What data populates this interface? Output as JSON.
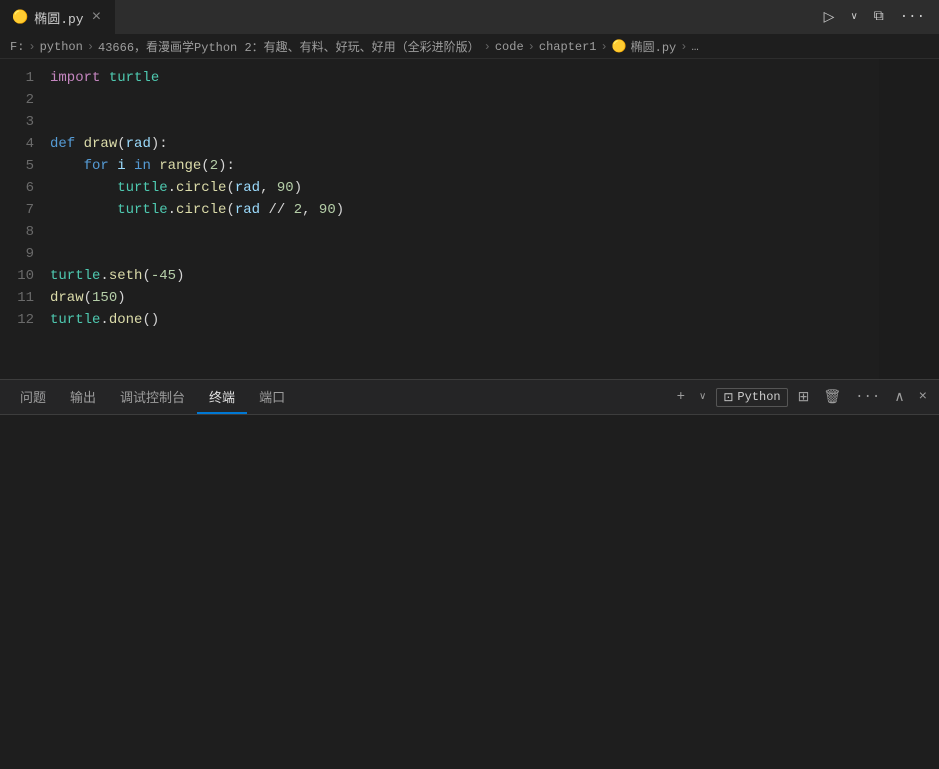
{
  "tab": {
    "icon": "🟡",
    "filename": "椭圆.py",
    "close_label": "×"
  },
  "tab_actions": {
    "run": "▷",
    "run_dropdown": "∨",
    "split": "⧉",
    "more": "···"
  },
  "breadcrumb": {
    "items": [
      "F:",
      "python",
      "43666，看漫画学Python 2：有趣、有料、好玩、好用（全彩进阶版）",
      "code",
      "chapter1",
      "椭圆.py",
      "…"
    ]
  },
  "code": {
    "lines": [
      {
        "num": "1",
        "tokens": [
          {
            "t": "kw2",
            "v": "import"
          },
          {
            "t": "plain",
            "v": " "
          },
          {
            "t": "mod",
            "v": "turtle"
          }
        ]
      },
      {
        "num": "2",
        "tokens": []
      },
      {
        "num": "3",
        "tokens": []
      },
      {
        "num": "4",
        "tokens": [
          {
            "t": "kw",
            "v": "def"
          },
          {
            "t": "plain",
            "v": " "
          },
          {
            "t": "fn",
            "v": "draw"
          },
          {
            "t": "plain",
            "v": "("
          },
          {
            "t": "attr",
            "v": "rad"
          },
          {
            "t": "plain",
            "v": "):"
          }
        ]
      },
      {
        "num": "5",
        "tokens": [
          {
            "t": "plain",
            "v": "    "
          },
          {
            "t": "kw",
            "v": "for"
          },
          {
            "t": "plain",
            "v": " "
          },
          {
            "t": "attr",
            "v": "i"
          },
          {
            "t": "plain",
            "v": " "
          },
          {
            "t": "kw",
            "v": "in"
          },
          {
            "t": "plain",
            "v": " "
          },
          {
            "t": "fn",
            "v": "range"
          },
          {
            "t": "plain",
            "v": "("
          },
          {
            "t": "num",
            "v": "2"
          },
          {
            "t": "plain",
            "v": "):"
          }
        ]
      },
      {
        "num": "6",
        "tokens": [
          {
            "t": "plain",
            "v": "        "
          },
          {
            "t": "mod",
            "v": "turtle"
          },
          {
            "t": "plain",
            "v": "."
          },
          {
            "t": "fn",
            "v": "circle"
          },
          {
            "t": "plain",
            "v": "("
          },
          {
            "t": "attr",
            "v": "rad"
          },
          {
            "t": "plain",
            "v": ", "
          },
          {
            "t": "num",
            "v": "90"
          },
          {
            "t": "plain",
            "v": ")"
          }
        ]
      },
      {
        "num": "7",
        "tokens": [
          {
            "t": "plain",
            "v": "        "
          },
          {
            "t": "mod",
            "v": "turtle"
          },
          {
            "t": "plain",
            "v": "."
          },
          {
            "t": "fn",
            "v": "circle"
          },
          {
            "t": "plain",
            "v": "("
          },
          {
            "t": "attr",
            "v": "rad"
          },
          {
            "t": "plain",
            "v": " // "
          },
          {
            "t": "num",
            "v": "2"
          },
          {
            "t": "plain",
            "v": ", "
          },
          {
            "t": "num",
            "v": "90"
          },
          {
            "t": "plain",
            "v": ")"
          }
        ]
      },
      {
        "num": "8",
        "tokens": []
      },
      {
        "num": "9",
        "tokens": []
      },
      {
        "num": "10",
        "tokens": [
          {
            "t": "mod",
            "v": "turtle"
          },
          {
            "t": "plain",
            "v": "."
          },
          {
            "t": "fn",
            "v": "seth"
          },
          {
            "t": "plain",
            "v": "("
          },
          {
            "t": "num",
            "v": "-45"
          },
          {
            "t": "plain",
            "v": ")"
          }
        ]
      },
      {
        "num": "11",
        "tokens": [
          {
            "t": "fn",
            "v": "draw"
          },
          {
            "t": "plain",
            "v": "("
          },
          {
            "t": "num",
            "v": "150"
          },
          {
            "t": "plain",
            "v": ")"
          }
        ]
      },
      {
        "num": "12",
        "tokens": [
          {
            "t": "mod",
            "v": "turtle"
          },
          {
            "t": "plain",
            "v": "."
          },
          {
            "t": "fn",
            "v": "done"
          },
          {
            "t": "plain",
            "v": "()"
          }
        ]
      }
    ]
  },
  "panel": {
    "tabs": [
      {
        "label": "问题",
        "active": false
      },
      {
        "label": "输出",
        "active": false
      },
      {
        "label": "调试控制台",
        "active": false
      },
      {
        "label": "终端",
        "active": true
      },
      {
        "label": "端口",
        "active": false
      }
    ],
    "actions": {
      "add": "+",
      "add_dropdown": "∨",
      "terminal_icon": "⊡",
      "python_label": "Python",
      "split": "⊞",
      "trash": "🗑",
      "more": "···",
      "up": "∧",
      "close": "×"
    }
  }
}
